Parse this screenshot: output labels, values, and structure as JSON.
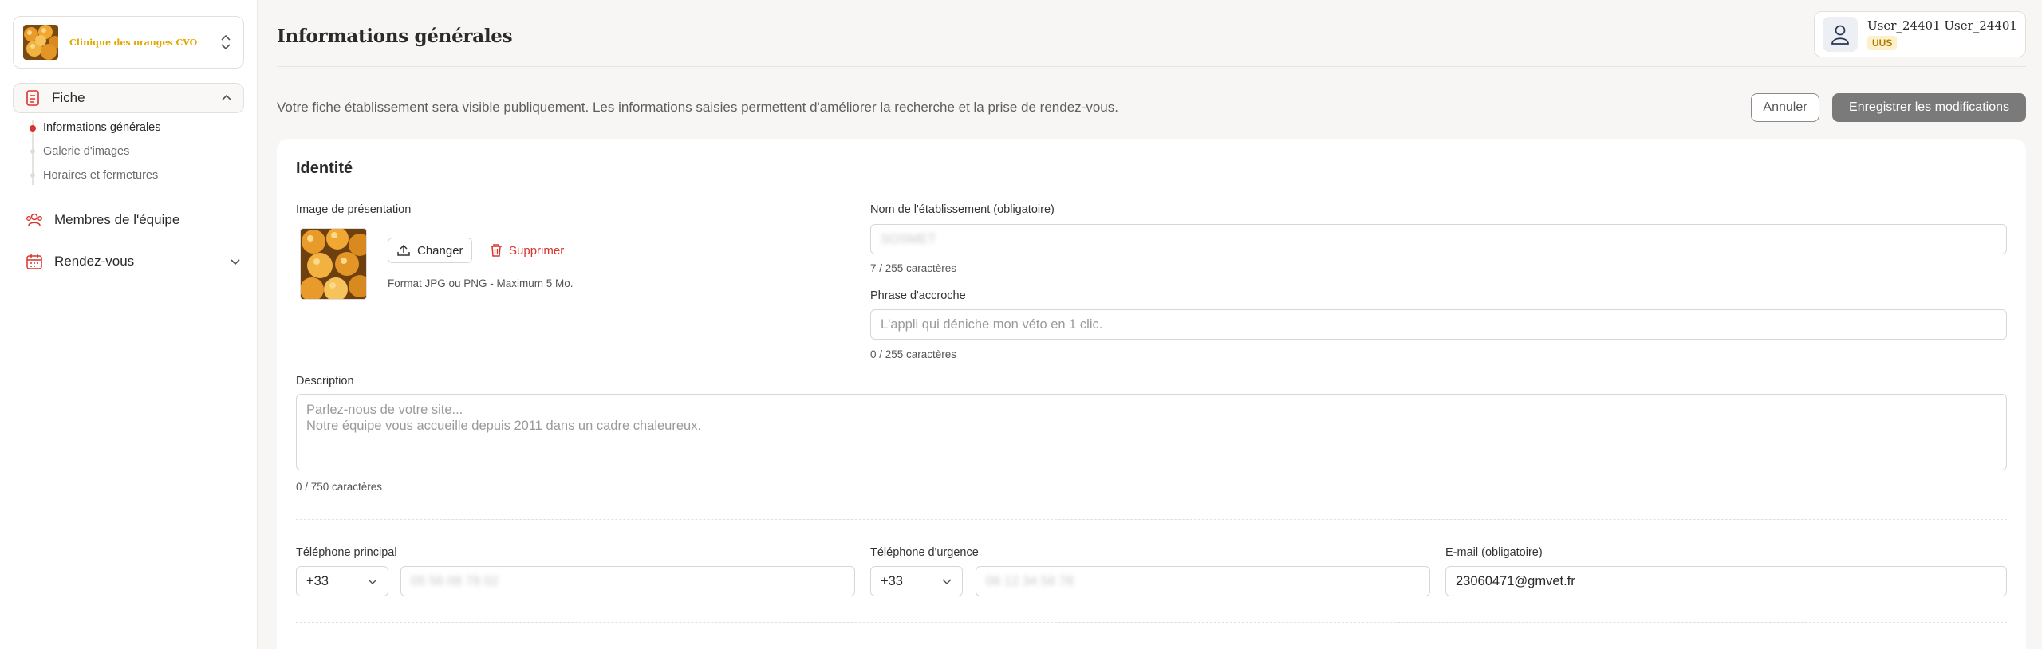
{
  "sidebar": {
    "clinic_name": "Clinique des oranges CVO",
    "fiche_label": "Fiche",
    "sub_items": [
      "Informations générales",
      "Galerie d'images",
      "Horaires et fermetures"
    ],
    "team_label": "Membres de l'équipe",
    "appointments_label": "Rendez-vous"
  },
  "header": {
    "title": "Informations générales",
    "user_name": "User_24401 User_24401",
    "user_badge": "UUS"
  },
  "toolbar": {
    "intro": "Votre fiche établissement sera visible publiquement. Les informations saisies permettent d'améliorer la recherche et la prise de rendez-vous.",
    "cancel_label": "Annuler",
    "save_label": "Enregistrer les modifications"
  },
  "identity": {
    "section_title": "Identité",
    "image_label": "Image de présentation",
    "change_label": "Changer",
    "delete_label": "Supprimer",
    "format_hint": "Format JPG ou PNG - Maximum 5 Mo.",
    "name_label": "Nom de l'établissement (obligatoire)",
    "name_value": "SOSMET",
    "name_count": "7 / 255 caractères",
    "tagline_label": "Phrase d'accroche",
    "tagline_placeholder": "L'appli qui déniche mon véto en 1 clic.",
    "tagline_count": "0 / 255 caractères",
    "description_label": "Description",
    "description_placeholder": "Parlez-nous de votre site...\nNotre équipe vous accueille depuis 2011 dans un cadre chaleureux.",
    "description_count": "0 / 750 caractères"
  },
  "contact": {
    "phone_label": "Téléphone principal",
    "phone_prefix": "+33",
    "phone_value": "05 56 08 78 02",
    "urgent_label": "Téléphone d'urgence",
    "urgent_prefix": "+33",
    "urgent_value": "06 12 34 56 78",
    "email_label": "E-mail (obligatoire)",
    "email_value": "23060471@gmvet.fr"
  },
  "colors": {
    "accent_red": "#d9342b",
    "clinic_gold": "#e0a800",
    "save_button": "#7a7a7a"
  }
}
